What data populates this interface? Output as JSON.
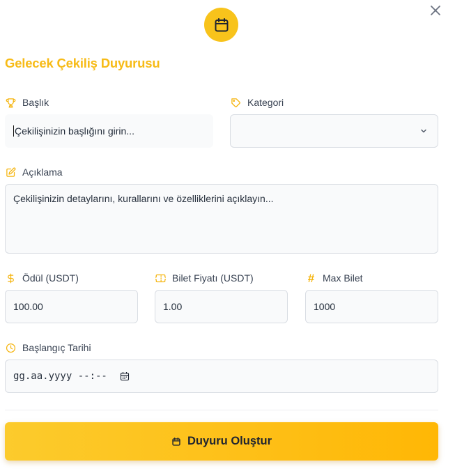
{
  "modal": {
    "title": "Gelecek Çekiliş Duyurusu",
    "header_icon": "calendar-icon",
    "close_icon": "close-icon",
    "accent_color": "#f8c31b",
    "title_color": "#f7bb17"
  },
  "form": {
    "title_field": {
      "label": "Başlık",
      "icon": "trophy-icon",
      "placeholder": "Çekilişinizin başlığını girin..."
    },
    "category_field": {
      "label": "Kategori",
      "icon": "tag-icon",
      "value": ""
    },
    "description_field": {
      "label": "Açıklama",
      "icon": "edit-icon",
      "placeholder": "Çekilişinizin detaylarını, kurallarını ve özelliklerini açıklayın..."
    },
    "prize_field": {
      "label": "Ödül (USDT)",
      "icon": "dollar-icon",
      "value": "100.00"
    },
    "ticket_price_field": {
      "label": "Bilet Fiyatı (USDT)",
      "icon": "ticket-icon",
      "value": "1.00"
    },
    "max_tickets_field": {
      "label": "Max Bilet",
      "icon": "hash-icon",
      "icon_glyph": "#",
      "value": "1000"
    },
    "start_date_field": {
      "label": "Başlangıç Tarihi",
      "icon": "clock-icon",
      "placeholder": "gg.aa.yyyy --:--"
    }
  },
  "submit": {
    "label": "Duyuru Oluştur",
    "icon": "calendar-icon"
  }
}
